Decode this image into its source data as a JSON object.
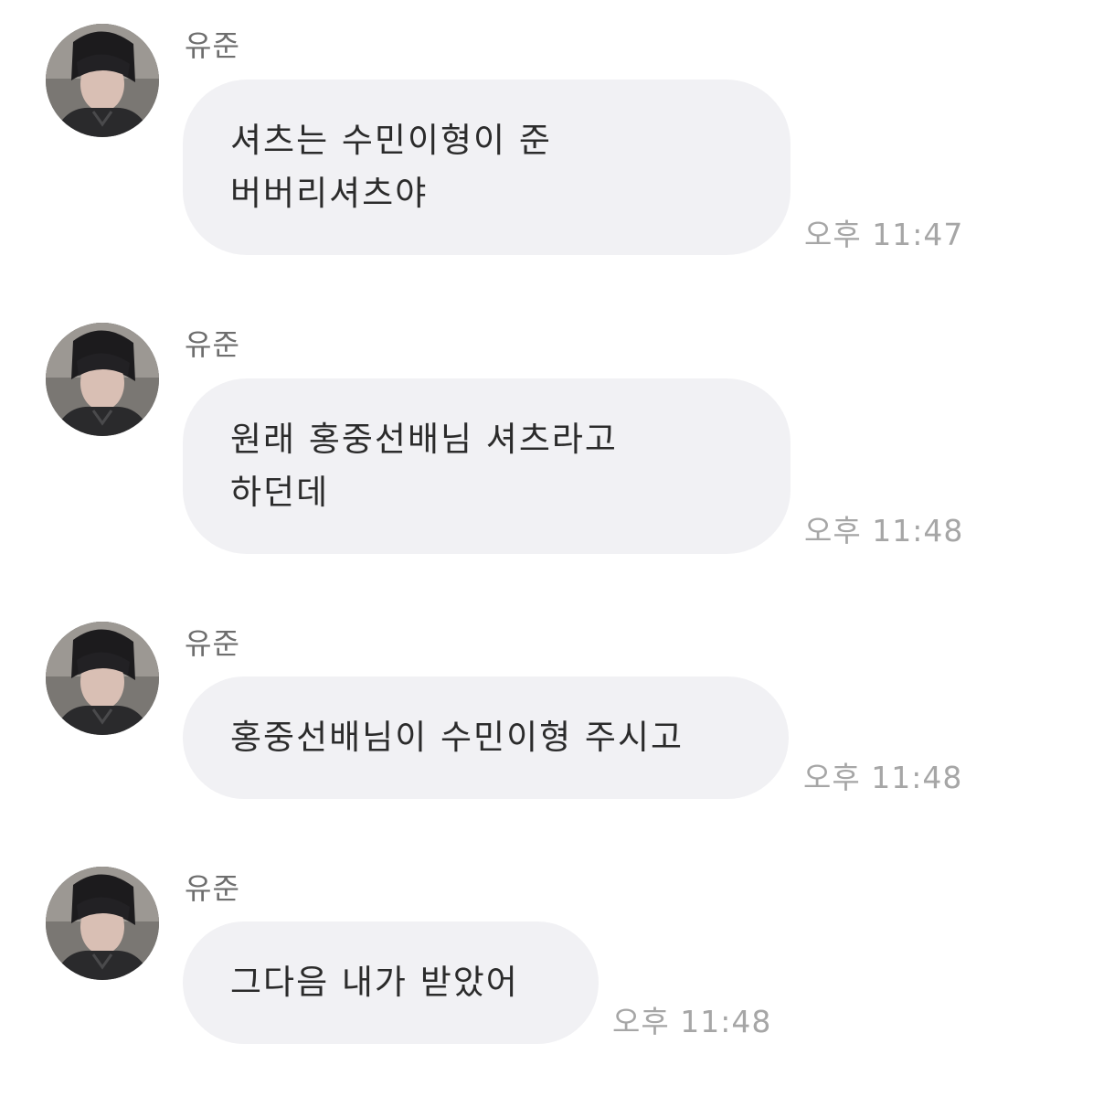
{
  "messages": [
    {
      "sender": "유준",
      "lines": [
        "셔츠는 수민이형이 준",
        "버버리셔츠야"
      ],
      "time": "오후 11:47",
      "avatar_icon": "profile-photo"
    },
    {
      "sender": "유준",
      "lines": [
        "원래 홍중선배님 셔츠라고",
        "하던데"
      ],
      "time": "오후 11:48",
      "avatar_icon": "profile-photo"
    },
    {
      "sender": "유준",
      "lines": [
        "홍중선배님이 수민이형 주시고"
      ],
      "time": "오후 11:48",
      "avatar_icon": "profile-photo"
    },
    {
      "sender": "유준",
      "lines": [
        "그다음 내가 받았어"
      ],
      "time": "오후 11:48",
      "avatar_icon": "profile-photo"
    }
  ],
  "colors": {
    "background": "#ffffff",
    "bubble": "#f1f1f4",
    "message_text": "#2b2b2b",
    "sender_text": "#6e6e6e",
    "time_text": "#a6a6a6"
  }
}
